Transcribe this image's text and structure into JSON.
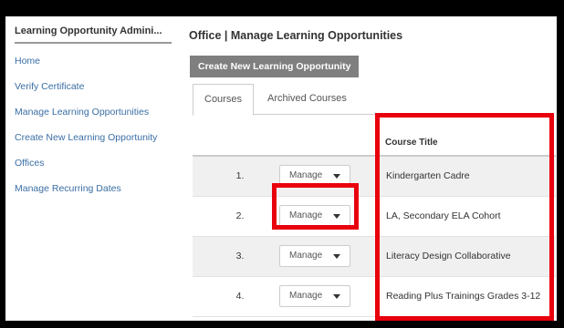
{
  "sidebar": {
    "title": "Learning Opportunity Admini...",
    "items": [
      {
        "label": "Home"
      },
      {
        "label": "Verify Certificate"
      },
      {
        "label": "Manage Learning Opportunities"
      },
      {
        "label": "Create New Learning Opportunity"
      },
      {
        "label": "Offices"
      },
      {
        "label": "Manage Recurring Dates"
      }
    ]
  },
  "main": {
    "title": "Office | Manage Learning Opportunities",
    "create_button": "Create New Learning Opportunity",
    "tabs": [
      {
        "label": "Courses",
        "active": true
      },
      {
        "label": "Archived Courses",
        "active": false
      }
    ]
  },
  "table": {
    "column_title": "Course Title",
    "rows": [
      {
        "num": "1.",
        "action": "Manage",
        "title": "Kindergarten Cadre"
      },
      {
        "num": "2.",
        "action": "Manage",
        "title": "LA, Secondary ELA Cohort"
      },
      {
        "num": "3.",
        "action": "Manage",
        "title": "Literacy Design Collaborative"
      },
      {
        "num": "4.",
        "action": "Manage",
        "title": "Reading Plus Trainings Grades 3-12"
      }
    ]
  },
  "colors": {
    "highlight": "#e8000d",
    "link": "#3a6ea5",
    "button": "#7f7f7f"
  }
}
